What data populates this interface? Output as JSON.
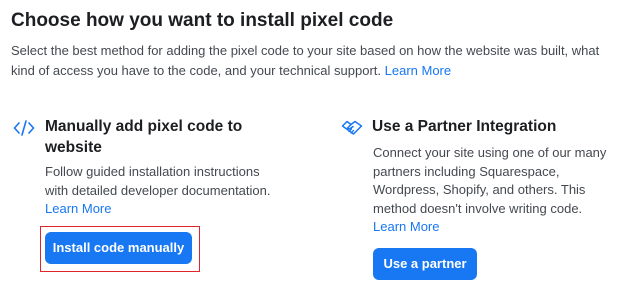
{
  "header": {
    "title": "Choose how you want to install pixel code",
    "description": "Select the best method for adding the pixel code to your site based on how the website was built, what kind of access you have to the code, and your technical support.",
    "learn_more": "Learn More"
  },
  "options": {
    "manual": {
      "icon": "code-icon",
      "title": "Manually add pixel code to website",
      "body": "Follow guided installation instructions with detailed developer documentation.",
      "learn_more": "Learn More",
      "button_label": "Install code manually"
    },
    "partner": {
      "icon": "handshake-icon",
      "title": "Use a Partner Integration",
      "body": "Connect your site using one of our many partners including Squarespace, Wordpress, Shopify, and others. This method doesn't involve writing code.",
      "learn_more": "Learn More",
      "button_label": "Use a partner"
    }
  },
  "colors": {
    "accent": "#1877f2",
    "highlight_border": "#e0242a",
    "text_primary": "#1c1e21",
    "text_secondary": "#444950"
  }
}
